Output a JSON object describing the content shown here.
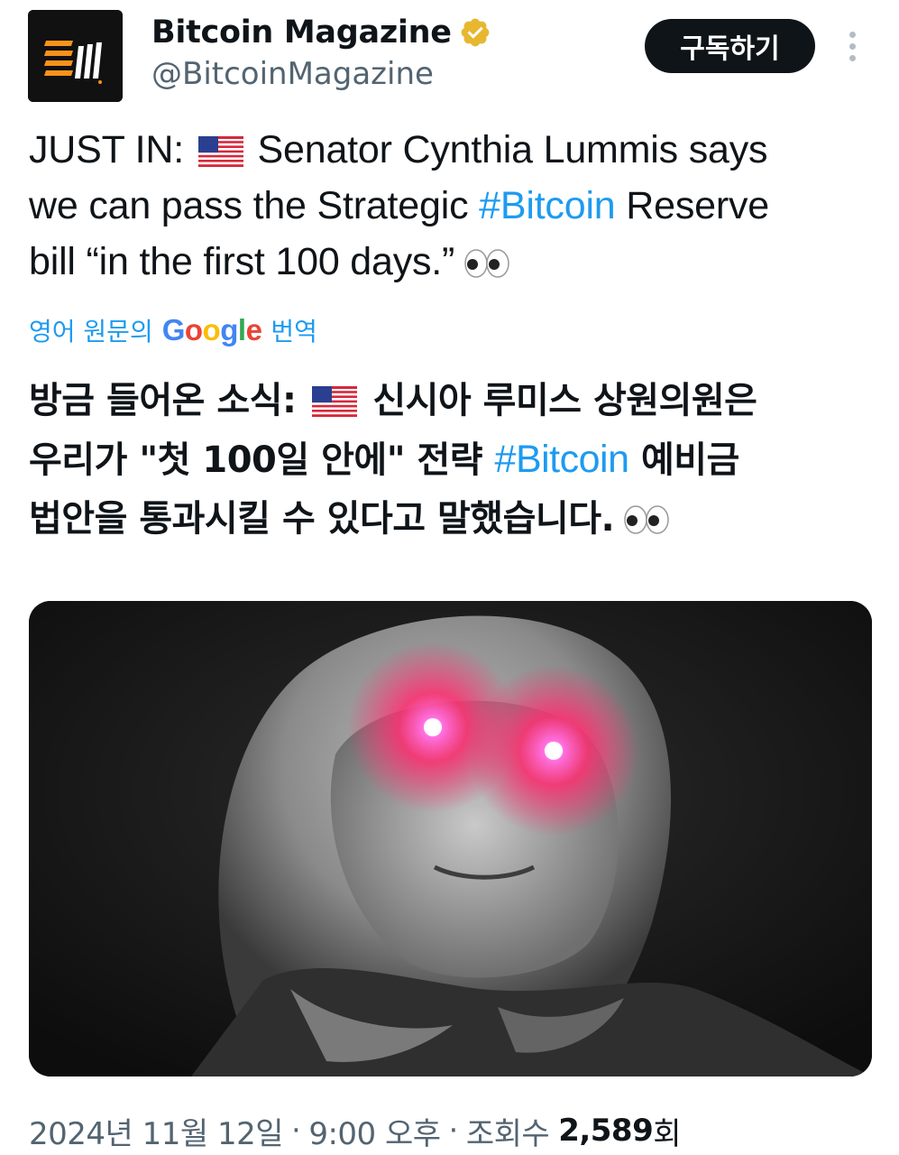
{
  "author": {
    "display_name": "Bitcoin Magazine",
    "handle": "@BitcoinMagazine",
    "verified_icon": "verified-badge-gold",
    "avatar_icon": "bitcoin-magazine-logo"
  },
  "actions": {
    "subscribe_label": "구독하기",
    "more_icon": "more-vertical-icon"
  },
  "tweet": {
    "line1_prefix": "JUST IN:",
    "line1_suffix": "Senator Cynthia Lummis says",
    "line2_prefix": "we can pass the Strategic",
    "hashtag": "#Bitcoin",
    "line2_suffix": "Reserve",
    "line3": "bill “in the first 100 days.”",
    "flag_icon": "us-flag-emoji",
    "eyes_icon": "eyes-emoji"
  },
  "translate": {
    "prefix": "영어 원문의",
    "google": "Google",
    "suffix": "번역"
  },
  "translation": {
    "line1_prefix": "방금 들어온 소식:",
    "line1_suffix": "신시아 루미스 상원의원은",
    "line2_prefix": "우리가 \"첫 100일 안에\" 전략",
    "hashtag": "#Bitcoin",
    "line2_suffix": "예비금",
    "line3": "법안을 통과시킬 수 있다고 말했습니다."
  },
  "media": {
    "icon": "photo-senator-laser-eyes"
  },
  "meta": {
    "date": "2024년 11월 12일",
    "time": "9:00 오후",
    "views_label": "조회수",
    "views_count": "2,589",
    "views_unit": "회",
    "separator": "·"
  },
  "colors": {
    "accent": "#1d9bf0",
    "text": "#0f1419",
    "secondary": "#536471",
    "button_bg": "#0f1419",
    "verified": "#e8b730",
    "laser": "#ff2d6f"
  }
}
